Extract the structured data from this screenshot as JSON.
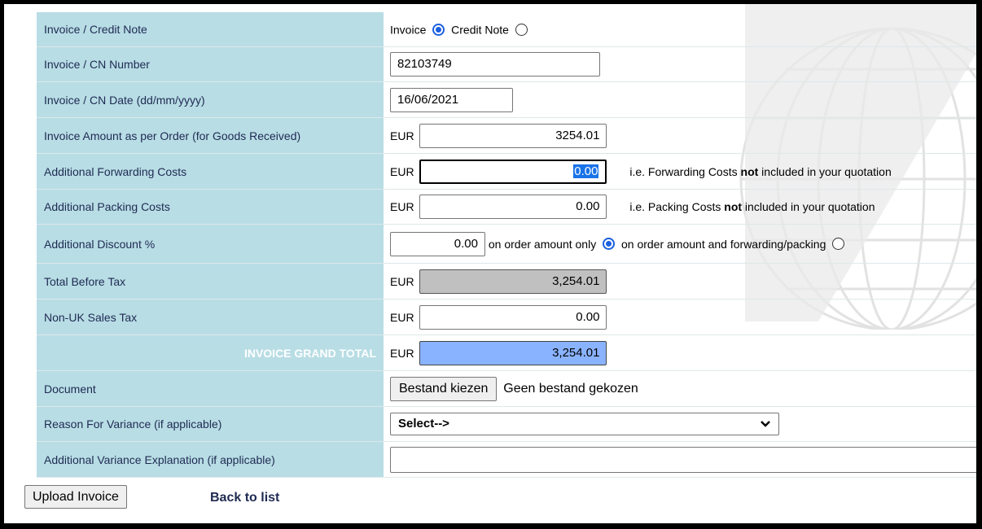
{
  "form": {
    "doc_type": {
      "label": "Invoice / Credit Note",
      "invoice_label": "Invoice",
      "credit_note_label": "Credit Note",
      "selected": "Invoice"
    },
    "number": {
      "label": "Invoice / CN Number",
      "value": "82103749"
    },
    "date": {
      "label": "Invoice / CN Date (dd/mm/yyyy)",
      "value": "16/06/2021"
    },
    "amount": {
      "label": "Invoice Amount as per Order (for Goods Received)",
      "currency": "EUR",
      "value": "3254.01"
    },
    "forwarding": {
      "label": "Additional Forwarding Costs",
      "currency": "EUR",
      "value": "0.00",
      "hint_pre": "i.e. Forwarding Costs ",
      "hint_bold": "not",
      "hint_post": " included in your quotation"
    },
    "packing": {
      "label": "Additional Packing Costs",
      "currency": "EUR",
      "value": "0.00",
      "hint_pre": "i.e. Packing Costs ",
      "hint_bold": "not",
      "hint_post": " included in your quotation"
    },
    "discount": {
      "label": "Additional Discount %",
      "value": "0.00",
      "option1": "on order amount only",
      "option2": "on order amount and forwarding/packing",
      "selected": "on order amount only"
    },
    "total_before_tax": {
      "label": "Total Before Tax",
      "currency": "EUR",
      "value": "3,254.01"
    },
    "sales_tax": {
      "label": "Non-UK Sales Tax",
      "currency": "EUR",
      "value": "0.00"
    },
    "grand_total": {
      "label": "INVOICE GRAND TOTAL",
      "currency": "EUR",
      "value": "3,254.01"
    },
    "document": {
      "label": "Document",
      "button": "Bestand kiezen",
      "status": "Geen bestand gekozen"
    },
    "variance_reason": {
      "label": "Reason For Variance (if applicable)",
      "value": "Select-->"
    },
    "variance_explanation": {
      "label": "Additional Variance Explanation (if applicable)",
      "value": ""
    }
  },
  "actions": {
    "upload": "Upload Invoice",
    "back": "Back to list"
  },
  "colors": {
    "label_bg": "#b8dde5",
    "label_text": "#1f2a52",
    "grand_total_bg": "#8ab3ff",
    "readonly_bg": "#c0c0c0",
    "radio_accent": "#1a5fe0"
  },
  "icons": {
    "dropdown": "chevron-down-icon",
    "background": "globe-logo-watermark"
  }
}
